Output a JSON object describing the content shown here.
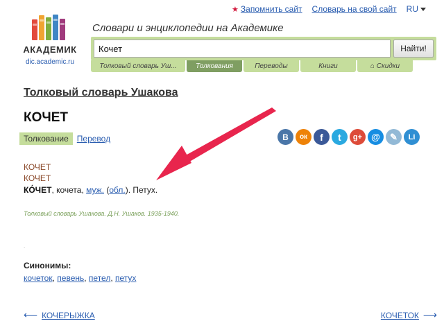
{
  "top_links": {
    "remember": "Запомнить сайт",
    "dictionary_for_site": "Словарь на свой сайт",
    "language": "RU"
  },
  "logo": {
    "name": "АКАДЕМИК",
    "url": "dic.academic.ru"
  },
  "search": {
    "tagline": "Словари и энциклопедии на Академике",
    "value": "Кочет",
    "button": "Найти!"
  },
  "tabs": [
    {
      "label": "Толковый словарь Уш..."
    },
    {
      "label": "Толкования"
    },
    {
      "label": "Переводы"
    },
    {
      "label": "Книги"
    },
    {
      "label": "Скидки"
    }
  ],
  "content": {
    "dictionary_title": "Толковый словарь Ушакова",
    "word_title": "КОЧЕТ",
    "subnav": {
      "active": "Толкование",
      "link": "Перевод"
    },
    "entry_heads": [
      "КОЧЕТ",
      "КОЧЕТ"
    ],
    "entry": {
      "headword": "КО́ЧЕТ",
      "form": ", кочета, ",
      "gender": "муж.",
      "sep1": " (",
      "region": "обл.",
      "definition": "). Петух."
    },
    "source": "Толковый словарь Ушакова. Д.Н. Ушаков. 1935-1940.",
    "synonyms_title": "Синонимы",
    "synonyms": [
      "кочеток",
      "певень",
      "петел",
      "петух"
    ]
  },
  "social": [
    {
      "icon": "vk-icon",
      "glyph": "В",
      "color": "#4a76a8"
    },
    {
      "icon": "odnoklassniki-icon",
      "glyph": "ок",
      "color": "#ee8208"
    },
    {
      "icon": "facebook-icon",
      "glyph": "f",
      "color": "#3b5998"
    },
    {
      "icon": "twitter-icon",
      "glyph": "t",
      "color": "#2aa9e0"
    },
    {
      "icon": "google-plus-icon",
      "glyph": "g+",
      "color": "#dd4b39"
    },
    {
      "icon": "mail-icon",
      "glyph": "@",
      "color": "#168de2"
    },
    {
      "icon": "livejournal-icon",
      "glyph": "✎",
      "color": "#92b9d6"
    },
    {
      "icon": "liveinternet-icon",
      "glyph": "Li",
      "color": "#2f8fd3"
    }
  ],
  "navigation": {
    "prev": "КОЧЕРЫЖКА",
    "next": "КОЧЕТОК"
  },
  "colors": {
    "accent_green": "#c5dd9c",
    "active_tab": "#7f9e62",
    "link": "#2a5db0",
    "annotation_arrow": "#e8254d"
  }
}
